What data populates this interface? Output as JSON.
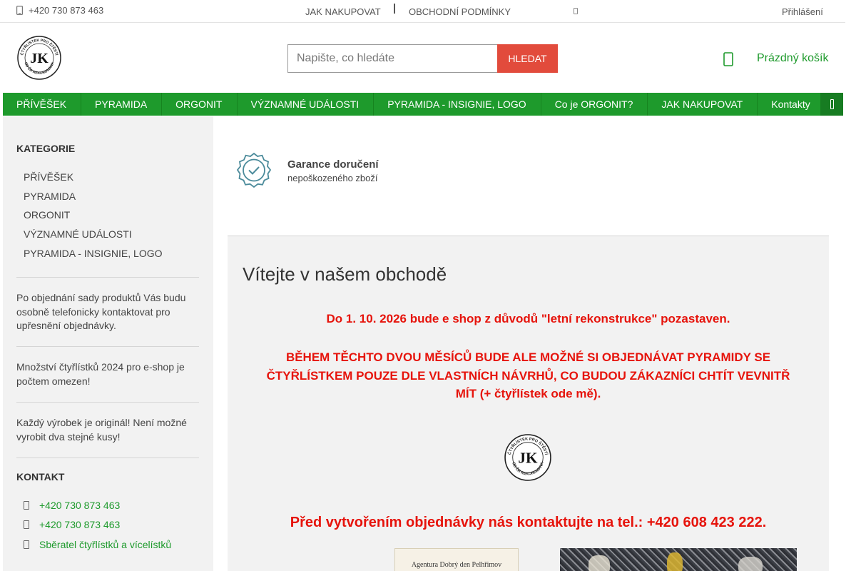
{
  "topbar": {
    "phone": "+420 730 873 463",
    "links": [
      "JAK NAKUPOVAT",
      "OBCHODNÍ PODMÍNKY"
    ],
    "login": "Přihlášení"
  },
  "logo": {
    "text_top": "ČTYŘLÍSTEK PRO ŠTĚSTÍ",
    "text_bottom": "OD ČR REKORDMANA",
    "monogram": "JK"
  },
  "search": {
    "placeholder": "Napište, co hledáte",
    "button": "HLEDAT"
  },
  "cart": {
    "label": "Prázdný košík",
    "icon": "cart-icon"
  },
  "nav": {
    "items": [
      "PŘÍVĚŠEK",
      "PYRAMIDA",
      "ORGONIT",
      "VÝZNAMNÉ UDÁLOSTI",
      "PYRAMIDA - INSIGNIE, LOGO",
      "Co je ORGONIT?",
      "JAK NAKUPOVAT",
      "Kontakty"
    ]
  },
  "sidebar": {
    "categories_title": "KATEGORIE",
    "categories": [
      "PŘÍVĚŠEK",
      "PYRAMIDA",
      "ORGONIT",
      "VÝZNAMNÉ UDÁLOSTI",
      "PYRAMIDA - INSIGNIE, LOGO"
    ],
    "notes": [
      "Po objednání sady produktů Vás budu osobně telefonicky kontaktovat pro upřesnění objednávky.",
      "Množství čtyřlístků 2024 pro e-shop je počtem omezen!",
      "Každý výrobek je originál! Není možné vyrobit dva stejné kusy!"
    ],
    "contact_title": "KONTAKT",
    "contacts": [
      "+420 730 873 463",
      "+420 730 873 463",
      "Sběratel čtyřlístků a vícelístků"
    ]
  },
  "guarantee": {
    "title": "Garance doručení",
    "subtitle": "nepoškozeného zboží"
  },
  "main": {
    "welcome": "Vítejte v našem obchodě",
    "notice1": "Do 1. 10. 2026 bude e shop z důvodů \"letní rekonstrukce\" pozastaven.",
    "notice2": "BĚHEM TĚCHTO DVOU MĚSÍCŮ BUDE ALE MOŽNÉ SI OBJEDNÁVAT PYRAMIDY SE ČTYŘLÍSTKEM POUZE DLE VLASTNÍCH NÁVRHŮ, CO BUDOU ZÁKAZNÍCI CHTÍT VEVNITŘ MÍT (+ čtyřlístek ode mě).",
    "notice3": "Před vytvořením objednávky nás kontaktujte na tel.: +420 608 423 222.",
    "image1_caption": "Agentura Dobrý den Pelhřimov"
  },
  "colors": {
    "brand_green": "#1e9a2c",
    "alert_red": "#e6140c",
    "search_button": "#e24b3c"
  }
}
